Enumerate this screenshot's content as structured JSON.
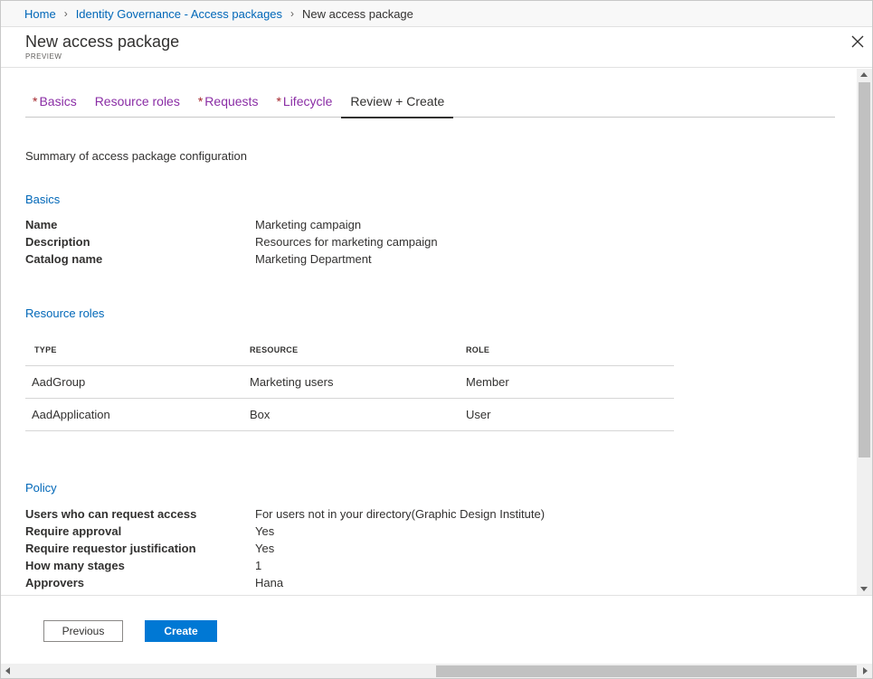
{
  "breadcrumb": {
    "home": "Home",
    "sep1": "›",
    "governance": "Identity Governance - Access packages",
    "sep2": "›",
    "current": "New access package"
  },
  "header": {
    "title": "New access package",
    "subtitle": "PREVIEW",
    "close_icon": "close-icon"
  },
  "tabs": [
    {
      "required": "*",
      "label": "Basics"
    },
    {
      "required": "",
      "label": "Resource roles"
    },
    {
      "required": "*",
      "label": "Requests"
    },
    {
      "required": "*",
      "label": "Lifecycle"
    },
    {
      "required": "",
      "label": "Review + Create"
    }
  ],
  "summary": "Summary of access package configuration",
  "basics": {
    "title": "Basics",
    "rows": [
      {
        "key": "Name",
        "value": "Marketing campaign"
      },
      {
        "key": "Description",
        "value": "Resources for marketing campaign"
      },
      {
        "key": "Catalog name",
        "value": "Marketing Department"
      }
    ]
  },
  "resource_roles": {
    "title": "Resource roles",
    "columns": [
      "TYPE",
      "RESOURCE",
      "ROLE"
    ],
    "rows": [
      [
        "AadGroup",
        "Marketing users",
        "Member"
      ],
      [
        "AadApplication",
        "Box",
        "User"
      ]
    ]
  },
  "policy": {
    "title": "Policy",
    "rows": [
      {
        "key": "Users who can request access",
        "value": "For users not in your directory(Graphic Design Institute)"
      },
      {
        "key": "Require approval",
        "value": "Yes"
      },
      {
        "key": "Require requestor justification",
        "value": "Yes"
      },
      {
        "key": "How many stages",
        "value": "1"
      },
      {
        "key": "Approvers",
        "value": "Hana"
      }
    ]
  },
  "footer": {
    "previous": "Previous",
    "create": "Create"
  },
  "colors": {
    "link": "#0067b8",
    "tab": "#8a2da5",
    "required": "#a4262c",
    "primary": "#0078d4"
  }
}
